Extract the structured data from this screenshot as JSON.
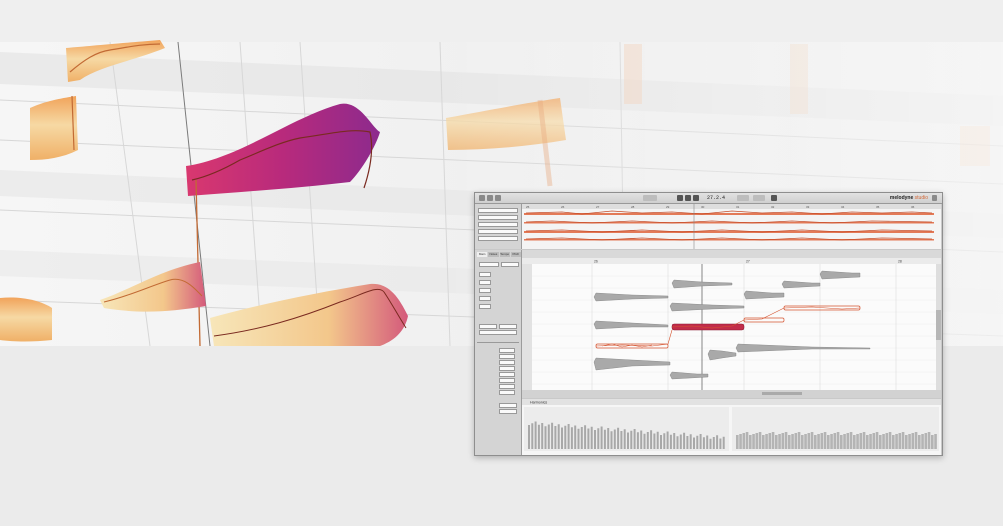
{
  "app": {
    "name": "melodyne",
    "edition": "studio",
    "time_display": "27.2.4"
  },
  "bars": {
    "overview_ruler": [
      "25",
      "26",
      "27",
      "28",
      "29",
      "30",
      "31",
      "32",
      "33",
      "34",
      "35",
      "36"
    ],
    "editor_ruler": [
      "26",
      "27",
      "28"
    ]
  },
  "editor": {
    "tabs": [
      "Main",
      "Notes",
      "Tempo",
      "Pitch"
    ],
    "bottom_label": "Harmonics"
  },
  "colors": {
    "accent": "#d5532f",
    "selected_note": "#c22d4a",
    "note_gray": "#9a9a9a",
    "hero_magenta": "#c9306e",
    "hero_cream": "#f6dcae"
  }
}
